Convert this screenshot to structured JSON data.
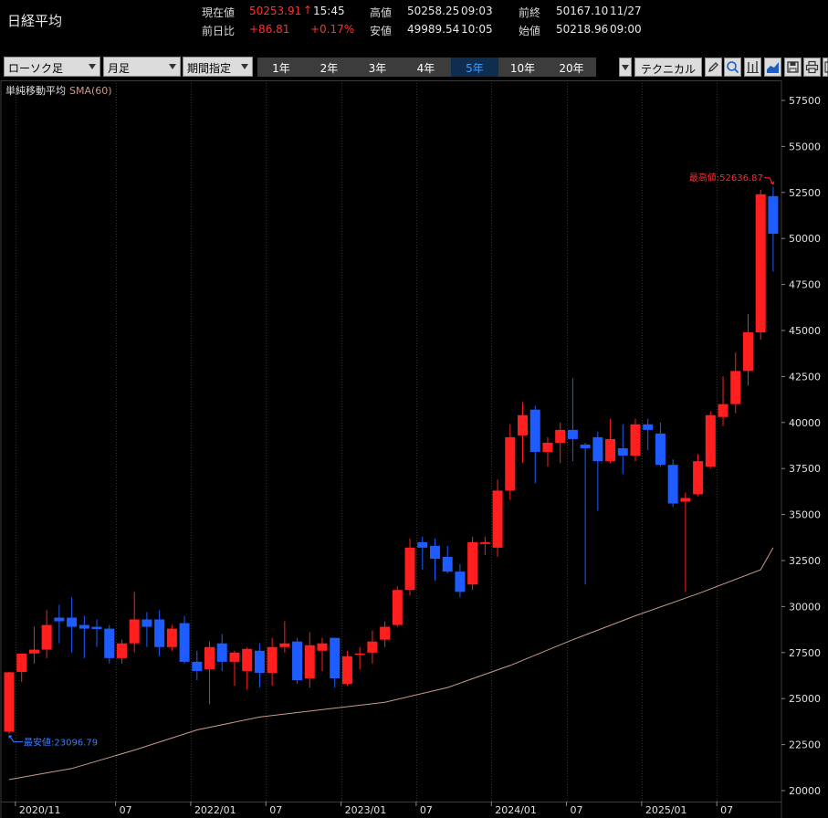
{
  "header": {
    "title": "日経平均",
    "current_label": "現在値",
    "current_value": "50253.91",
    "up_arrow": "↑",
    "current_time": "15:45",
    "change_label": "前日比",
    "change_value": "+86.81",
    "change_pct": "+0.17%",
    "high_label": "高値",
    "high_value": "50258.25",
    "high_time": "09:03",
    "low_label": "安値",
    "low_value": "49989.54",
    "low_time": "10:05",
    "prev_close_label": "前終",
    "prev_close_value": "50167.10",
    "prev_close_date": "11/27",
    "open_label": "始値",
    "open_value": "50218.96",
    "open_time": "09:00"
  },
  "toolbar": {
    "chart_type": "ローソク足",
    "interval": "月足",
    "range_mode": "期間指定",
    "periods": [
      "1年",
      "2年",
      "3年",
      "4年",
      "5年",
      "10年",
      "20年"
    ],
    "active_period": "5年",
    "technical": "テクニカル",
    "icons": [
      "pencil-icon",
      "zoom-icon",
      "bar-chart-icon",
      "area-chart-icon",
      "save-icon",
      "print-icon",
      "export-icon"
    ]
  },
  "colors": {
    "up": "#ff1f1f",
    "down": "#1e5cff",
    "sma": "#c89a8a",
    "grid_vertical": "#333333",
    "axis_text": "#e0e0e0"
  },
  "chart_data": {
    "type": "candlestick",
    "interval": "monthly",
    "indicator_label": "単純移動平均",
    "sma_label": "SMA(60)",
    "max_label": "最高値:52636.87",
    "min_label": "最安値:23096.79",
    "ylim": [
      20000,
      58000
    ],
    "y_ticks": [
      20000,
      22500,
      25000,
      27500,
      30000,
      32500,
      35000,
      37500,
      40000,
      42500,
      45000,
      47500,
      50000,
      52500,
      55000,
      57500
    ],
    "x_tick_labels": [
      {
        "idx": 1,
        "label": "2020/11"
      },
      {
        "idx": 9,
        "label": "07"
      },
      {
        "idx": 15,
        "label": "2022/01"
      },
      {
        "idx": 21,
        "label": "07"
      },
      {
        "idx": 27,
        "label": "2023/01"
      },
      {
        "idx": 33,
        "label": "07"
      },
      {
        "idx": 39,
        "label": "2024/01"
      },
      {
        "idx": 45,
        "label": "07"
      },
      {
        "idx": 51,
        "label": "2025/01"
      },
      {
        "idx": 57,
        "label": "07"
      }
    ],
    "candles": [
      {
        "o": 23200,
        "h": 26450,
        "l": 23096.79,
        "c": 26430
      },
      {
        "o": 26450,
        "h": 27450,
        "l": 25900,
        "c": 27440
      },
      {
        "o": 27450,
        "h": 28900,
        "l": 26900,
        "c": 27660
      },
      {
        "o": 27660,
        "h": 29800,
        "l": 27200,
        "c": 29000
      },
      {
        "o": 29400,
        "h": 30100,
        "l": 28000,
        "c": 29200
      },
      {
        "o": 29400,
        "h": 30500,
        "l": 27500,
        "c": 28900
      },
      {
        "o": 29000,
        "h": 29500,
        "l": 27200,
        "c": 28800
      },
      {
        "o": 28900,
        "h": 29300,
        "l": 27800,
        "c": 28780
      },
      {
        "o": 28800,
        "h": 29000,
        "l": 26900,
        "c": 27200
      },
      {
        "o": 27200,
        "h": 28200,
        "l": 26900,
        "c": 28000
      },
      {
        "o": 28000,
        "h": 30800,
        "l": 27500,
        "c": 29300
      },
      {
        "o": 29300,
        "h": 29700,
        "l": 27800,
        "c": 28900
      },
      {
        "o": 29300,
        "h": 29800,
        "l": 27300,
        "c": 27800
      },
      {
        "o": 27800,
        "h": 29000,
        "l": 27600,
        "c": 28800
      },
      {
        "o": 29100,
        "h": 29500,
        "l": 26900,
        "c": 27000
      },
      {
        "o": 27000,
        "h": 27600,
        "l": 26000,
        "c": 26500
      },
      {
        "o": 26600,
        "h": 28100,
        "l": 24700,
        "c": 27800
      },
      {
        "o": 28000,
        "h": 28500,
        "l": 26500,
        "c": 27000
      },
      {
        "o": 27000,
        "h": 27600,
        "l": 25700,
        "c": 27500
      },
      {
        "o": 26500,
        "h": 27800,
        "l": 25500,
        "c": 27700
      },
      {
        "o": 27600,
        "h": 28000,
        "l": 25600,
        "c": 26400
      },
      {
        "o": 26400,
        "h": 28300,
        "l": 25700,
        "c": 27800
      },
      {
        "o": 27800,
        "h": 29200,
        "l": 27500,
        "c": 28000
      },
      {
        "o": 28100,
        "h": 28300,
        "l": 25800,
        "c": 26000
      },
      {
        "o": 26100,
        "h": 28600,
        "l": 25600,
        "c": 27900
      },
      {
        "o": 27600,
        "h": 28300,
        "l": 26500,
        "c": 28000
      },
      {
        "o": 28300,
        "h": 28300,
        "l": 25600,
        "c": 26100
      },
      {
        "o": 25800,
        "h": 27600,
        "l": 25700,
        "c": 27300
      },
      {
        "o": 27400,
        "h": 27800,
        "l": 26600,
        "c": 27450
      },
      {
        "o": 27500,
        "h": 28700,
        "l": 26900,
        "c": 28100
      },
      {
        "o": 28200,
        "h": 29200,
        "l": 27800,
        "c": 28900
      },
      {
        "o": 29000,
        "h": 31100,
        "l": 28900,
        "c": 30900
      },
      {
        "o": 30900,
        "h": 33700,
        "l": 30600,
        "c": 33200
      },
      {
        "o": 33500,
        "h": 33800,
        "l": 32000,
        "c": 33200
      },
      {
        "o": 33300,
        "h": 33700,
        "l": 31400,
        "c": 32600
      },
      {
        "o": 32700,
        "h": 33300,
        "l": 31800,
        "c": 31900
      },
      {
        "o": 31900,
        "h": 32300,
        "l": 30500,
        "c": 30800
      },
      {
        "o": 31200,
        "h": 33800,
        "l": 30900,
        "c": 33500
      },
      {
        "o": 33400,
        "h": 33800,
        "l": 32800,
        "c": 33500
      },
      {
        "o": 33200,
        "h": 36900,
        "l": 32700,
        "c": 36300
      },
      {
        "o": 36300,
        "h": 39900,
        "l": 35800,
        "c": 39200
      },
      {
        "o": 39300,
        "h": 41100,
        "l": 37800,
        "c": 40400
      },
      {
        "o": 40700,
        "h": 40900,
        "l": 36700,
        "c": 38400
      },
      {
        "o": 38400,
        "h": 39200,
        "l": 37600,
        "c": 38900
      },
      {
        "o": 38900,
        "h": 40000,
        "l": 37800,
        "c": 39600
      },
      {
        "o": 39600,
        "h": 42400,
        "l": 37900,
        "c": 39100
      },
      {
        "o": 38800,
        "h": 38900,
        "l": 31200,
        "c": 38600
      },
      {
        "o": 39200,
        "h": 39500,
        "l": 35200,
        "c": 37900
      },
      {
        "o": 37900,
        "h": 40200,
        "l": 37800,
        "c": 39100
      },
      {
        "o": 38600,
        "h": 39900,
        "l": 37200,
        "c": 38200
      },
      {
        "o": 38200,
        "h": 40200,
        "l": 37900,
        "c": 39900
      },
      {
        "o": 39900,
        "h": 40200,
        "l": 38500,
        "c": 39600
      },
      {
        "o": 39400,
        "h": 40000,
        "l": 37600,
        "c": 37700
      },
      {
        "o": 37700,
        "h": 38000,
        "l": 35400,
        "c": 35600
      },
      {
        "o": 35700,
        "h": 36200,
        "l": 30792.74,
        "c": 35900
      },
      {
        "o": 36100,
        "h": 38300,
        "l": 36000,
        "c": 37900
      },
      {
        "o": 37600,
        "h": 40600,
        "l": 37500,
        "c": 40400
      },
      {
        "o": 40300,
        "h": 42500,
        "l": 39800,
        "c": 41000
      },
      {
        "o": 41000,
        "h": 43800,
        "l": 40500,
        "c": 42800
      },
      {
        "o": 42800,
        "h": 45900,
        "l": 42000,
        "c": 44900
      },
      {
        "o": 44900,
        "h": 52636.87,
        "l": 44500,
        "c": 52400
      },
      {
        "o": 52300,
        "h": 52800,
        "l": 48200,
        "c": 50253.91
      }
    ],
    "sma60": [
      {
        "idx": 0,
        "v": 20600
      },
      {
        "idx": 5,
        "v": 21200
      },
      {
        "idx": 10,
        "v": 22200
      },
      {
        "idx": 15,
        "v": 23300
      },
      {
        "idx": 20,
        "v": 24000
      },
      {
        "idx": 25,
        "v": 24400
      },
      {
        "idx": 30,
        "v": 24800
      },
      {
        "idx": 35,
        "v": 25600
      },
      {
        "idx": 40,
        "v": 26800
      },
      {
        "idx": 45,
        "v": 28200
      },
      {
        "idx": 50,
        "v": 29500
      },
      {
        "idx": 55,
        "v": 30700
      },
      {
        "idx": 60,
        "v": 32000
      },
      {
        "idx": 61,
        "v": 33200
      }
    ]
  }
}
